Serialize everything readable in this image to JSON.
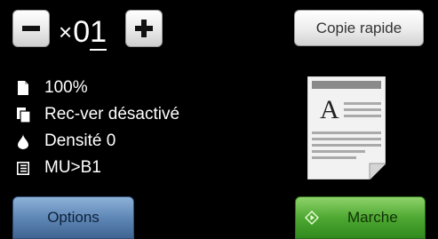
{
  "copies": {
    "prefix": "×",
    "count": "01"
  },
  "buttons": {
    "quick_copy": "Copie rapide",
    "options": "Options",
    "start": "Marche"
  },
  "settings": [
    {
      "icon": "page-icon",
      "label": "100%"
    },
    {
      "icon": "duplex-pages-icon",
      "label": "Rec-ver désactivé"
    },
    {
      "icon": "toner-drop-icon",
      "label": "Densité 0"
    },
    {
      "icon": "layout-list-icon",
      "label": "MU>B1"
    }
  ],
  "preview": {
    "letter": "A"
  },
  "colors": {
    "options_button": "#5f87b6",
    "start_button": "#4fa832",
    "background": "#000000"
  }
}
